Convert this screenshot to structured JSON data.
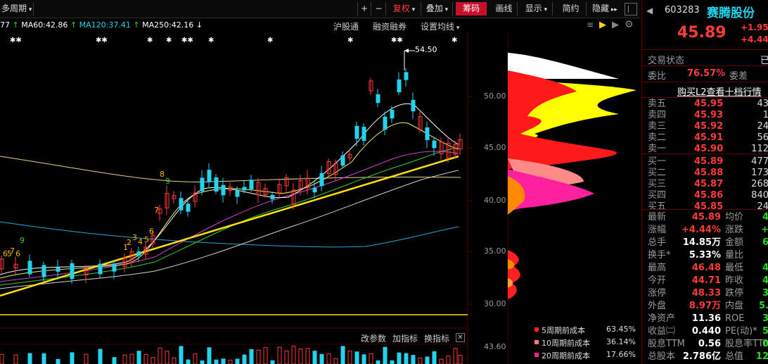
{
  "toolbar": {
    "period_label": "多周期",
    "plus": "+",
    "minus": "−",
    "fuquan": "复权",
    "overlay": "叠加",
    "chips": "筹码",
    "draw": "画线",
    "display": "显示",
    "simple": "简约",
    "hide": "隐藏"
  },
  "ma_legend": [
    {
      "text": "77",
      "color": "#ffffff"
    },
    {
      "text": "MA60:42.86",
      "color": "#ffffff"
    },
    {
      "text": "MA120:37.41",
      "color": "#22d3ee"
    },
    {
      "text": "MA250:42.16",
      "color": "#ffffff"
    }
  ],
  "chart_links": {
    "hugutong": "沪股通",
    "rongzi": "融资融券",
    "setma": "设置均线"
  },
  "annotation": "54.50",
  "price_axis": [
    "50.00",
    "45.00",
    "40.00",
    "35.00",
    "30.00"
  ],
  "vol_axis": "43.60",
  "bottom_links": {
    "params": "改参数",
    "add": "加指标",
    "switch": "换指标"
  },
  "cost_legend": [
    {
      "label": "5周期前成本",
      "value": "63.45%",
      "color": "#ff2020"
    },
    {
      "label": "10周期前成本",
      "value": "36.14%",
      "color": "#ff7f7f"
    },
    {
      "label": "20周期前成本",
      "value": "17.66%",
      "color": "#ff2090"
    }
  ],
  "td_numbers": [
    "6",
    "7",
    "5",
    "6",
    "9",
    "1",
    "2",
    "3",
    "4",
    "5",
    "6",
    "7",
    "8",
    "9"
  ],
  "stock": {
    "code": "603283",
    "name": "赛腾股份",
    "price": "45.89",
    "change": "+1.95",
    "change_pct": "+4.44%",
    "status_label": "交易状态",
    "status_value": "已",
    "weibi_label": "委比",
    "weibi_value": "76.57%",
    "weicha_label": "委差",
    "l2_link": "购买L2查看十档行情"
  },
  "asks": [
    {
      "label": "卖五",
      "price": "45.95",
      "vol": "43"
    },
    {
      "label": "卖四",
      "price": "45.93",
      "vol": "1"
    },
    {
      "label": "卖三",
      "price": "45.92",
      "vol": "24"
    },
    {
      "label": "卖二",
      "price": "45.91",
      "vol": "56"
    },
    {
      "label": "卖一",
      "price": "45.90",
      "vol": "112"
    }
  ],
  "bids": [
    {
      "label": "买一",
      "price": "45.89",
      "vol": "477"
    },
    {
      "label": "买二",
      "price": "45.88",
      "vol": "173"
    },
    {
      "label": "买三",
      "price": "45.87",
      "vol": "268"
    },
    {
      "label": "买四",
      "price": "45.86",
      "vol": "840"
    },
    {
      "label": "买五",
      "price": "45.85",
      "vol": "24"
    }
  ],
  "stats": [
    {
      "l1": "最新",
      "v1": "45.89",
      "c1": "#ff3b3b",
      "l2": "均价",
      "v2": "4"
    },
    {
      "l1": "涨幅",
      "v1": "+4.44%",
      "c1": "#ff3b3b",
      "l2": "涨跌",
      "v2": "+"
    },
    {
      "l1": "总手",
      "v1": "14.85万",
      "c1": "#ffffff",
      "l2": "金额",
      "v2": "6"
    },
    {
      "l1": "换手*",
      "v1": "5.33%",
      "c1": "#ffffff",
      "l2": "量比",
      "v2": ""
    },
    {
      "l1": "最高",
      "v1": "46.48",
      "c1": "#ff3b3b",
      "l2": "最低",
      "v2": "4"
    },
    {
      "l1": "今开",
      "v1": "44.71",
      "c1": "#ff3b3b",
      "l2": "昨收",
      "v2": "4"
    },
    {
      "l1": "涨停",
      "v1": "48.33",
      "c1": "#ff3b3b",
      "l2": "跌停",
      "v2": "3"
    },
    {
      "l1": "外盘",
      "v1": "8.97万",
      "c1": "#ff3b3b",
      "l2": "内盘",
      "v2": "5."
    },
    {
      "l1": "净资产",
      "v1": "11.36",
      "c1": "#ffffff",
      "l2": "ROE",
      "v2": "3"
    },
    {
      "l1": "收益㈡",
      "v1": "0.440",
      "c1": "#ffffff",
      "l2": "PE(动)*",
      "v2": "5"
    },
    {
      "l1": "股息TTM",
      "v1": "0.56",
      "c1": "#ffffff",
      "l2": "股息率TTM",
      "v2": "0"
    },
    {
      "l1": "总股本",
      "v1": "2.786亿",
      "c1": "#ffffff",
      "l2": "总值",
      "v2": "12"
    }
  ]
}
